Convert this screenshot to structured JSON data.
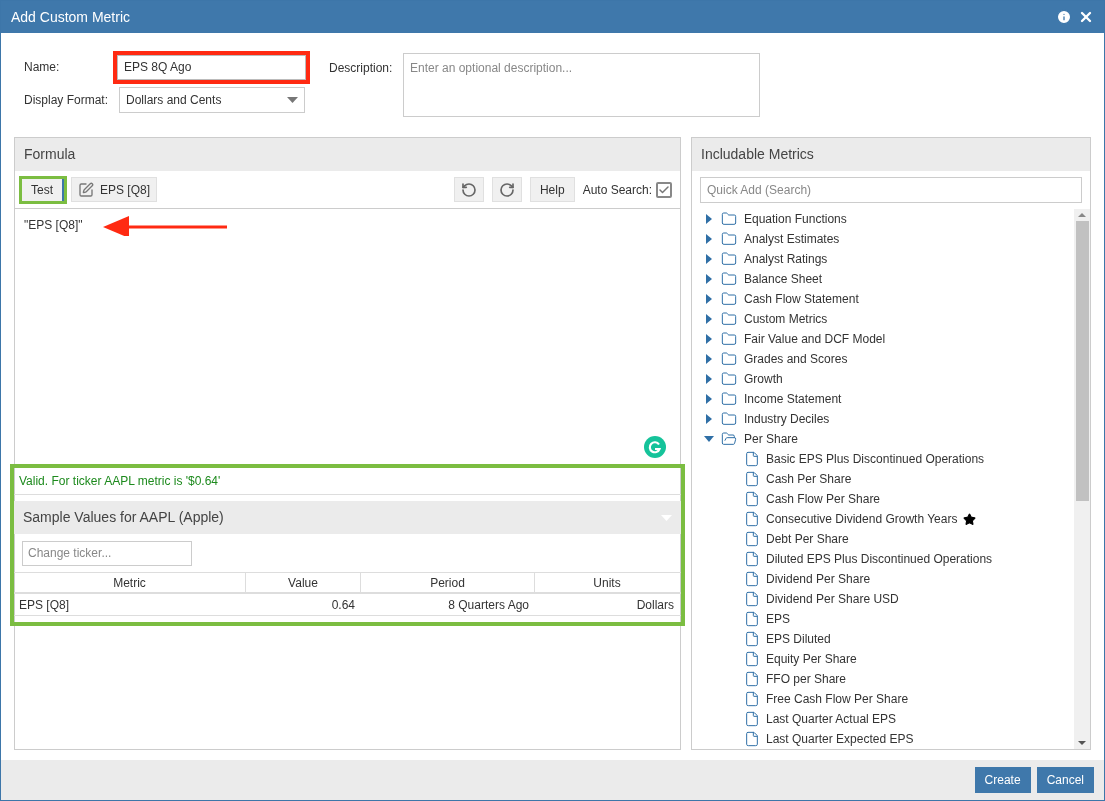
{
  "window": {
    "title": "Add Custom Metric"
  },
  "form": {
    "name_label": "Name:",
    "name_value": "EPS 8Q Ago",
    "description_label": "Description:",
    "description_placeholder": "Enter an optional description...",
    "format_label": "Display Format:",
    "format_value": "Dollars and Cents"
  },
  "formula": {
    "title": "Formula",
    "toolbar": {
      "test_button": "Test",
      "edit_button": "EPS [Q8]",
      "help_button": "Help",
      "auto_search_label": "Auto Search:",
      "auto_search_checked": true
    },
    "text": "\"EPS [Q8]\"",
    "validation": "Valid. For ticker AAPL metric is '$0.64'",
    "sample": {
      "title": "Sample Values for AAPL (Apple)",
      "ticker_placeholder": "Change ticker...",
      "columns": [
        "Metric",
        "Value",
        "Period",
        "Units"
      ],
      "rows": [
        [
          "EPS [Q8]",
          "0.64",
          "8 Quarters Ago",
          "Dollars"
        ]
      ]
    }
  },
  "metrics": {
    "title": "Includable Metrics",
    "search_placeholder": "Quick Add (Search)",
    "tree": [
      {
        "label": "Equation Functions",
        "expanded": false
      },
      {
        "label": "Analyst Estimates",
        "expanded": false
      },
      {
        "label": "Analyst Ratings",
        "expanded": false
      },
      {
        "label": "Balance Sheet",
        "expanded": false
      },
      {
        "label": "Cash Flow Statement",
        "expanded": false
      },
      {
        "label": "Custom Metrics",
        "expanded": false
      },
      {
        "label": "Fair Value and DCF Model",
        "expanded": false
      },
      {
        "label": "Grades and Scores",
        "expanded": false
      },
      {
        "label": "Growth",
        "expanded": false
      },
      {
        "label": "Income Statement",
        "expanded": false
      },
      {
        "label": "Industry Deciles",
        "expanded": false
      },
      {
        "label": "Per Share",
        "expanded": true,
        "children": [
          {
            "label": "Basic EPS Plus Discontinued Operations",
            "starred": false
          },
          {
            "label": "Cash Per Share",
            "starred": false
          },
          {
            "label": "Cash Flow Per Share",
            "starred": false
          },
          {
            "label": "Consecutive Dividend Growth Years",
            "starred": true
          },
          {
            "label": "Debt Per Share",
            "starred": false
          },
          {
            "label": "Diluted EPS Plus Discontinued Operations",
            "starred": false
          },
          {
            "label": "Dividend Per Share",
            "starred": false
          },
          {
            "label": "Dividend Per Share USD",
            "starred": false
          },
          {
            "label": "EPS",
            "starred": false
          },
          {
            "label": "EPS Diluted",
            "starred": false
          },
          {
            "label": "Equity Per Share",
            "starred": false
          },
          {
            "label": "FFO per Share",
            "starred": false
          },
          {
            "label": "Free Cash Flow Per Share",
            "starred": false
          },
          {
            "label": "Last Quarter Actual EPS",
            "starred": false
          },
          {
            "label": "Last Quarter Expected EPS",
            "starred": false
          }
        ]
      }
    ]
  },
  "footer": {
    "create_button": "Create",
    "cancel_button": "Cancel"
  }
}
